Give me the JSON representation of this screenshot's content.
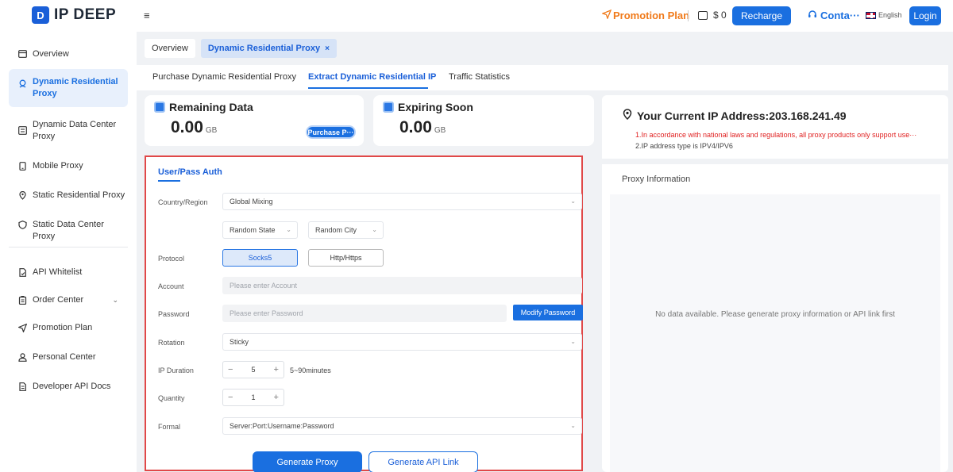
{
  "header": {
    "logo_text": "IP DEEP",
    "logo_mark": "D",
    "menu_icon": "≡",
    "promotion_label": "Promotion Plan",
    "balance": "$ 0",
    "recharge_label": "Recharge",
    "contact_label": "Conta···",
    "language": "English",
    "login_label": "Login"
  },
  "sidebar": {
    "items": [
      {
        "label": "Overview",
        "icon": "overview-icon"
      },
      {
        "label": "Dynamic Residential Proxy",
        "icon": "residential-icon"
      },
      {
        "label": "Dynamic Data Center Proxy",
        "icon": "datacenter-icon"
      },
      {
        "label": "Mobile Proxy",
        "icon": "mobile-icon"
      },
      {
        "label": "Static Residential Proxy",
        "icon": "location-icon"
      },
      {
        "label": "Static Data Center Proxy",
        "icon": "shield-icon"
      },
      {
        "label": "API Whitelist",
        "icon": "whitelist-icon"
      },
      {
        "label": "Order Center",
        "icon": "order-icon"
      },
      {
        "label": "Promotion Plan",
        "icon": "send-icon"
      },
      {
        "label": "Personal Center",
        "icon": "user-icon"
      },
      {
        "label": "Developer API Docs",
        "icon": "docs-icon"
      }
    ]
  },
  "tabs": [
    {
      "label": "Overview"
    },
    {
      "label": "Dynamic Residential Proxy",
      "close": "×"
    }
  ],
  "subnav": {
    "items": [
      "Purchase Dynamic Residential Proxy",
      "Extract Dynamic Residential IP",
      "Traffic Statistics"
    ]
  },
  "stats": {
    "remaining": {
      "title": "Remaining Data",
      "value": "0.00",
      "unit": "GB",
      "button": "Purchase P···"
    },
    "expiring": {
      "title": "Expiring Soon",
      "value": "0.00",
      "unit": "GB"
    }
  },
  "form": {
    "auth_tab": "User/Pass Auth",
    "country_label": "Country/Region",
    "country_value": "Global Mixing",
    "state_value": "Random State",
    "city_value": "Random City",
    "protocol_label": "Protocol",
    "protocol_options": [
      "Socks5",
      "Http/Https"
    ],
    "account_label": "Account",
    "account_placeholder": "Please enter Account",
    "password_label": "Password",
    "password_placeholder": "Please enter Password",
    "modify_password": "Modify Password",
    "rotation_label": "Rotation",
    "rotation_value": "Sticky",
    "duration_label": "IP Duration",
    "duration_value": "5",
    "duration_range": "5~90minutes",
    "quantity_label": "Quantity",
    "quantity_value": "1",
    "format_label": "Formal",
    "format_value": "Server:Port:Username:Password",
    "generate_proxy": "Generate Proxy",
    "generate_api": "Generate API Link"
  },
  "right": {
    "ip_title": "Your Current IP Address:203.168.241.49",
    "note1": "1.In accordance with national laws and regulations, all proxy products only support use···",
    "note2": "2.IP address type is IPV4/IPV6",
    "proxy_info_title": "Proxy Information",
    "no_data": "No data available. Please generate proxy information or API link first"
  },
  "colors": {
    "accent": "#1a6fe0",
    "promotion": "#f07a1a",
    "warning": "#e02020",
    "highlight_border": "#e04848"
  }
}
